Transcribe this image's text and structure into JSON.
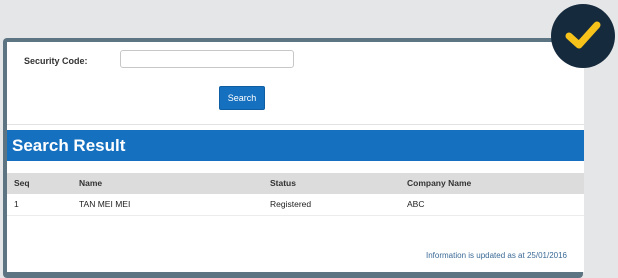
{
  "form": {
    "security_code_label": "Security Code:",
    "security_code_value": "",
    "search_button_label": "Search"
  },
  "results": {
    "title": "Search Result",
    "columns": [
      "Seq",
      "Name",
      "Status",
      "Company Name"
    ],
    "rows": [
      [
        "1",
        "TAN MEI MEI",
        "Registered",
        "ABC"
      ]
    ],
    "footnote": "Information is updated as at 25/01/2016"
  },
  "badge": {
    "icon": "checkmark-icon",
    "color": "#f7c31a",
    "background": "#152a3d"
  },
  "colors": {
    "accent": "#1570bf",
    "frame": "#5d7483"
  }
}
